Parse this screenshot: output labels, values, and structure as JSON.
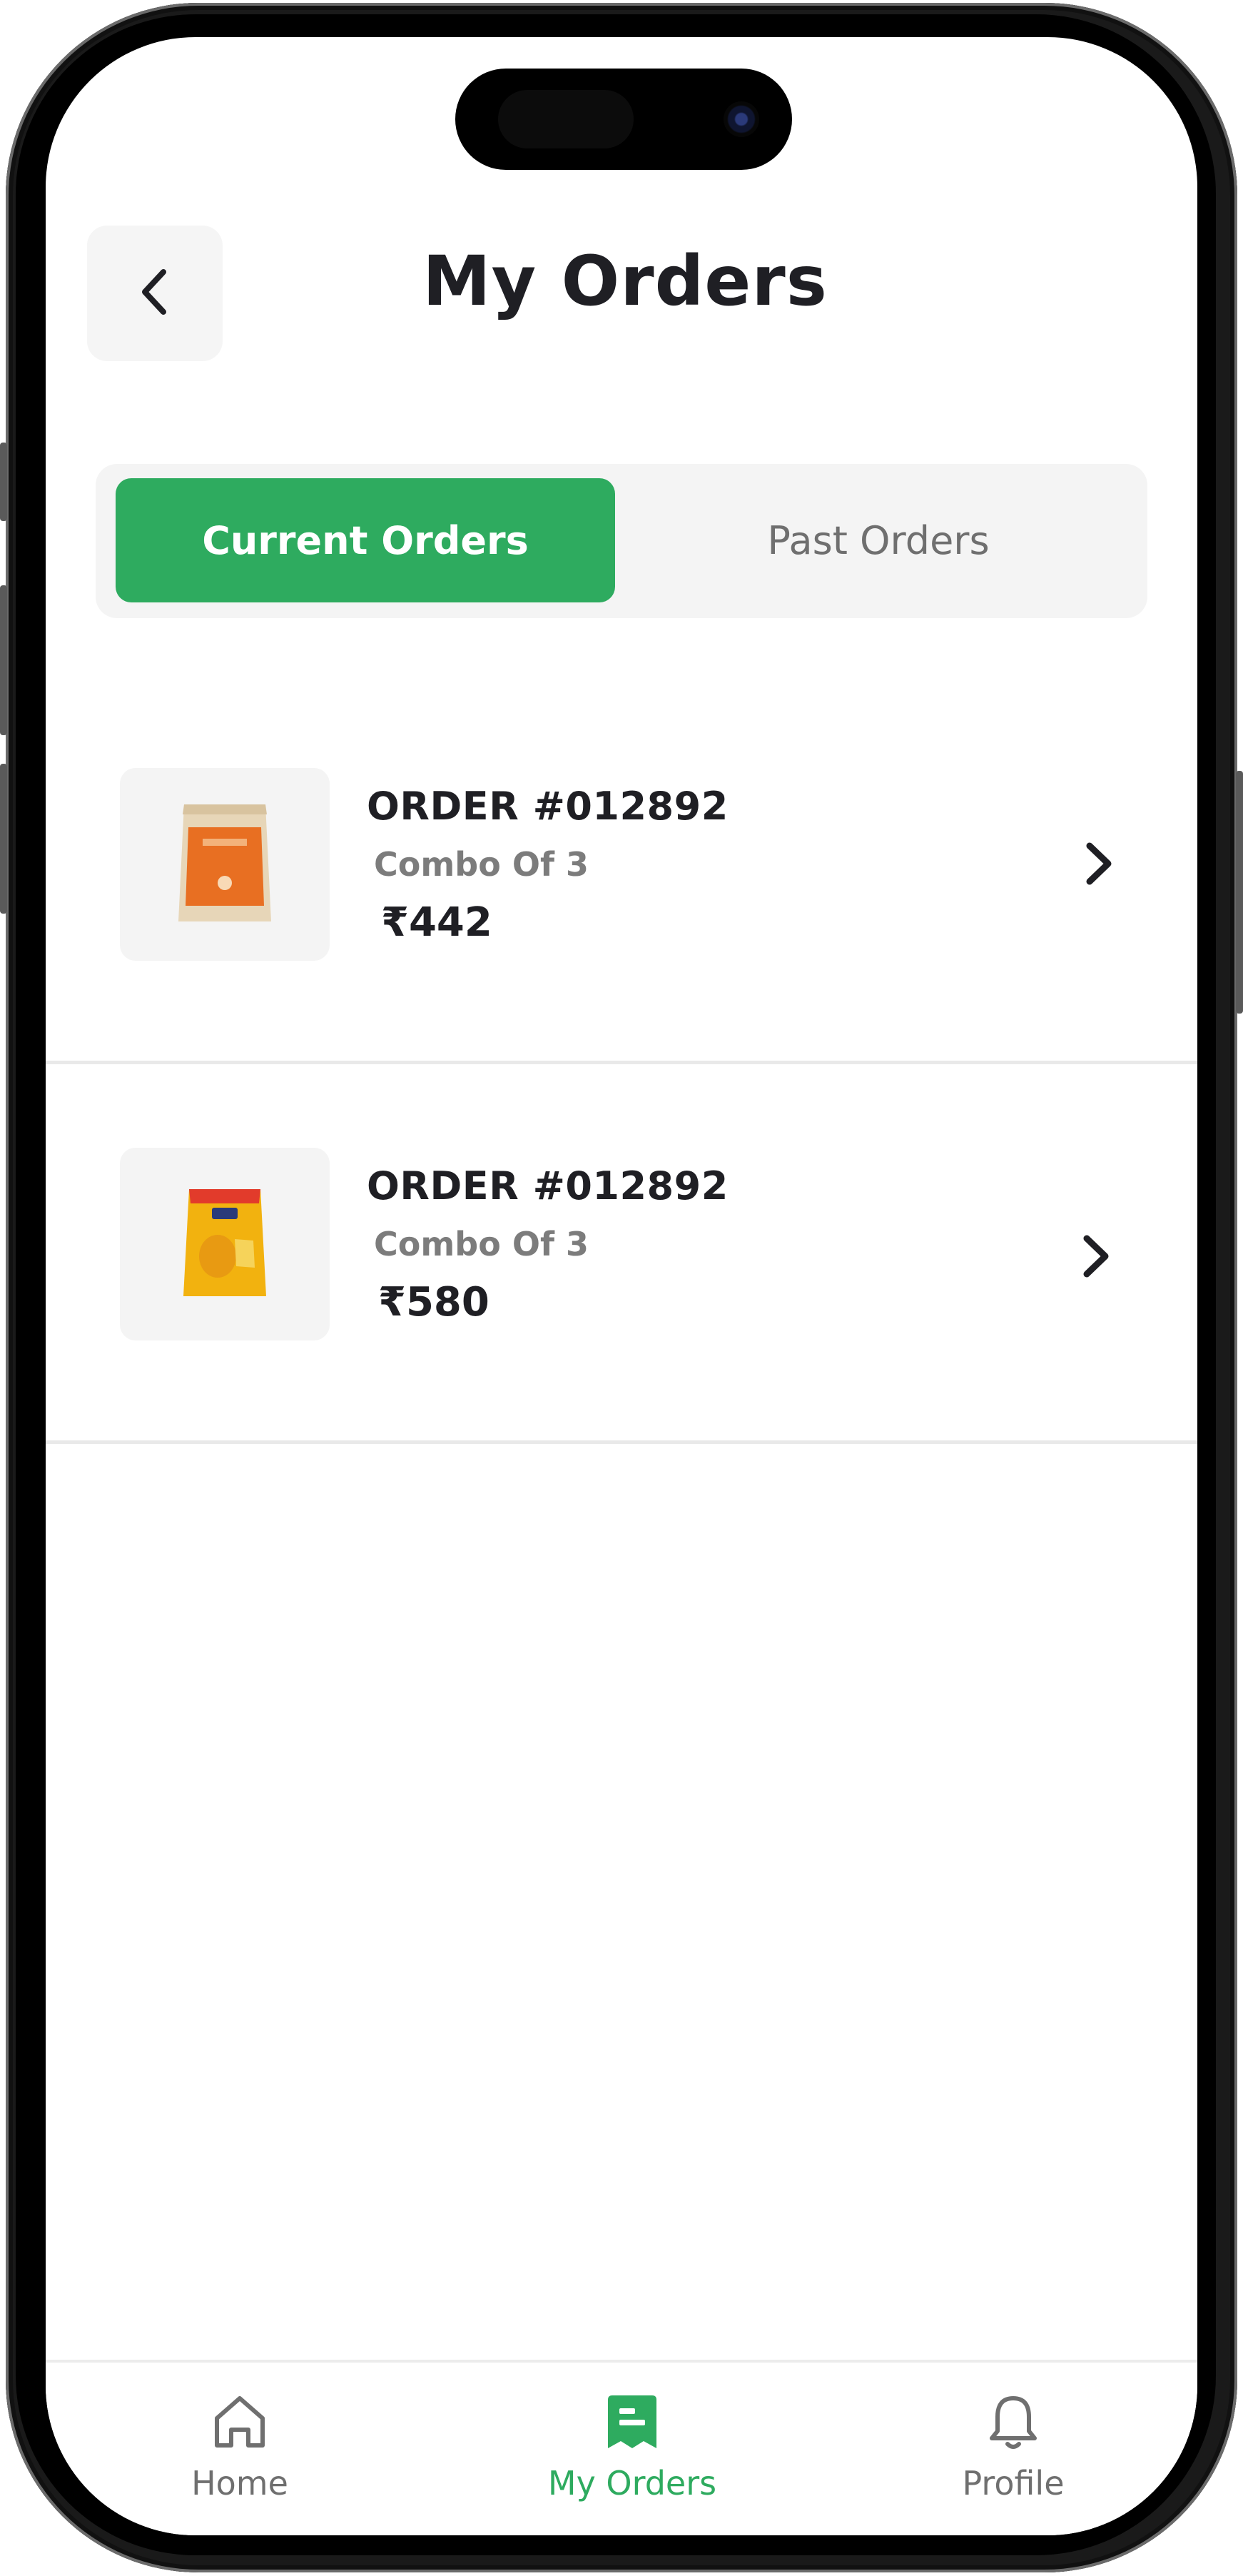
{
  "header": {
    "title": "My Orders"
  },
  "tabs": [
    {
      "label": "Current Orders",
      "active": true
    },
    {
      "label": "Past Orders",
      "active": false
    }
  ],
  "orders": [
    {
      "id": "ORDER #012892",
      "subtitle": "Combo Of 3",
      "price": "₹442",
      "thumbnail_icon": "atta-flour-pack-orange-icon"
    },
    {
      "id": "ORDER #012892",
      "subtitle": "Combo Of 3",
      "price": "₹580",
      "thumbnail_icon": "atta-flour-pack-yellow-icon"
    }
  ],
  "bottom_nav": [
    {
      "label": "Home",
      "icon": "home-icon",
      "active": false
    },
    {
      "label": "My Orders",
      "icon": "orders-receipt-icon",
      "active": true
    },
    {
      "label": "Profile",
      "icon": "bell-icon",
      "active": false
    }
  ],
  "colors": {
    "accent": "#2eab5f",
    "text_primary": "#1f1f24",
    "text_secondary": "#7c7c7c",
    "surface": "#f4f4f4"
  }
}
